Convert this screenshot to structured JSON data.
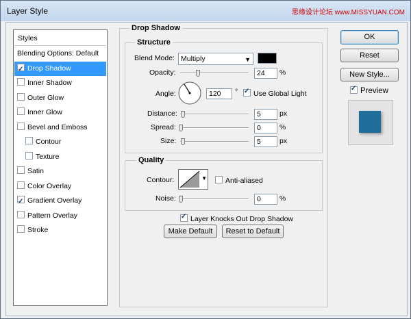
{
  "window": {
    "title": "Layer Style",
    "watermark": "思缘设计论坛 www.MISSYUAN.COM"
  },
  "styles_panel": {
    "header": "Styles",
    "items": [
      {
        "label": "Blending Options: Default",
        "checkbox": false,
        "checked": false,
        "selected": false,
        "indent": false
      },
      {
        "label": "Drop Shadow",
        "checkbox": true,
        "checked": true,
        "selected": true,
        "indent": false
      },
      {
        "label": "Inner Shadow",
        "checkbox": true,
        "checked": false,
        "selected": false,
        "indent": false
      },
      {
        "label": "Outer Glow",
        "checkbox": true,
        "checked": false,
        "selected": false,
        "indent": false
      },
      {
        "label": "Inner Glow",
        "checkbox": true,
        "checked": false,
        "selected": false,
        "indent": false
      },
      {
        "label": "Bevel and Emboss",
        "checkbox": true,
        "checked": false,
        "selected": false,
        "indent": false
      },
      {
        "label": "Contour",
        "checkbox": true,
        "checked": false,
        "selected": false,
        "indent": true
      },
      {
        "label": "Texture",
        "checkbox": true,
        "checked": false,
        "selected": false,
        "indent": true
      },
      {
        "label": "Satin",
        "checkbox": true,
        "checked": false,
        "selected": false,
        "indent": false
      },
      {
        "label": "Color Overlay",
        "checkbox": true,
        "checked": false,
        "selected": false,
        "indent": false
      },
      {
        "label": "Gradient Overlay",
        "checkbox": true,
        "checked": true,
        "selected": false,
        "indent": false
      },
      {
        "label": "Pattern Overlay",
        "checkbox": true,
        "checked": false,
        "selected": false,
        "indent": false
      },
      {
        "label": "Stroke",
        "checkbox": true,
        "checked": false,
        "selected": false,
        "indent": false
      }
    ]
  },
  "drop_shadow": {
    "title": "Drop Shadow",
    "structure": {
      "title": "Structure",
      "blend_mode_label": "Blend Mode:",
      "blend_mode_value": "Multiply",
      "shadow_color": "#000000",
      "opacity_label": "Opacity:",
      "opacity_value": "24",
      "opacity_unit": "%",
      "angle_label": "Angle:",
      "angle_value": "120",
      "angle_unit": "°",
      "use_global_light_label": "Use Global Light",
      "use_global_light_checked": true,
      "distance_label": "Distance:",
      "distance_value": "5",
      "distance_unit": "px",
      "spread_label": "Spread:",
      "spread_value": "0",
      "spread_unit": "%",
      "size_label": "Size:",
      "size_value": "5",
      "size_unit": "px"
    },
    "quality": {
      "title": "Quality",
      "contour_label": "Contour:",
      "anti_aliased_label": "Anti-aliased",
      "anti_aliased_checked": false,
      "noise_label": "Noise:",
      "noise_value": "0",
      "noise_unit": "%"
    },
    "knockout_label": "Layer Knocks Out Drop Shadow",
    "knockout_checked": true,
    "make_default_label": "Make Default",
    "reset_default_label": "Reset to Default"
  },
  "buttons": {
    "ok": "OK",
    "reset": "Reset",
    "new_style": "New Style...",
    "preview_label": "Preview",
    "preview_checked": true
  },
  "preview": {
    "swatch_color": "#1f6f9a"
  }
}
